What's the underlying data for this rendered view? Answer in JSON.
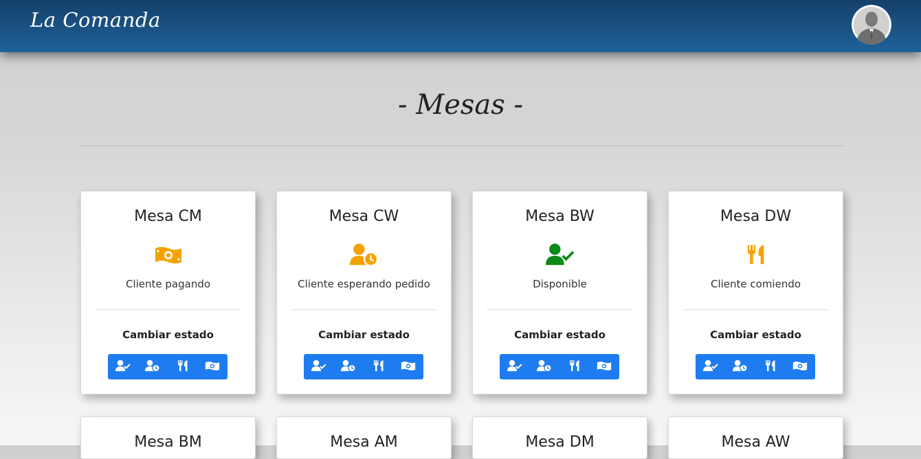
{
  "navbar": {
    "brand": "La Comanda",
    "avatar_icon": "user-avatar-icon"
  },
  "page": {
    "heading": "- Mesas -"
  },
  "colors": {
    "accent": "#1e7cf0",
    "navbar": "#1a5487",
    "orange": "#f5a200",
    "green": "#0c8a1a"
  },
  "change_label": "Cambiar estado",
  "buttons": [
    {
      "icon": "user-check-icon",
      "title": "Disponible"
    },
    {
      "icon": "user-clock-icon",
      "title": "Cliente esperando pedido"
    },
    {
      "icon": "utensils-icon",
      "title": "Cliente comiendo"
    },
    {
      "icon": "money-bill-icon",
      "title": "Cliente pagando"
    }
  ],
  "tables": [
    {
      "name": "Mesa CM",
      "status": "Cliente pagando",
      "icon": "money-bill-icon",
      "color": "#f5a200"
    },
    {
      "name": "Mesa CW",
      "status": "Cliente esperando pedido",
      "icon": "user-clock-icon",
      "color": "#f5a200"
    },
    {
      "name": "Mesa BW",
      "status": "Disponible",
      "icon": "user-check-icon",
      "color": "#0c8a1a"
    },
    {
      "name": "Mesa DW",
      "status": "Cliente comiendo",
      "icon": "utensils-icon",
      "color": "#f5a200"
    },
    {
      "name": "Mesa BM"
    },
    {
      "name": "Mesa AM"
    },
    {
      "name": "Mesa DM"
    },
    {
      "name": "Mesa AW"
    }
  ]
}
